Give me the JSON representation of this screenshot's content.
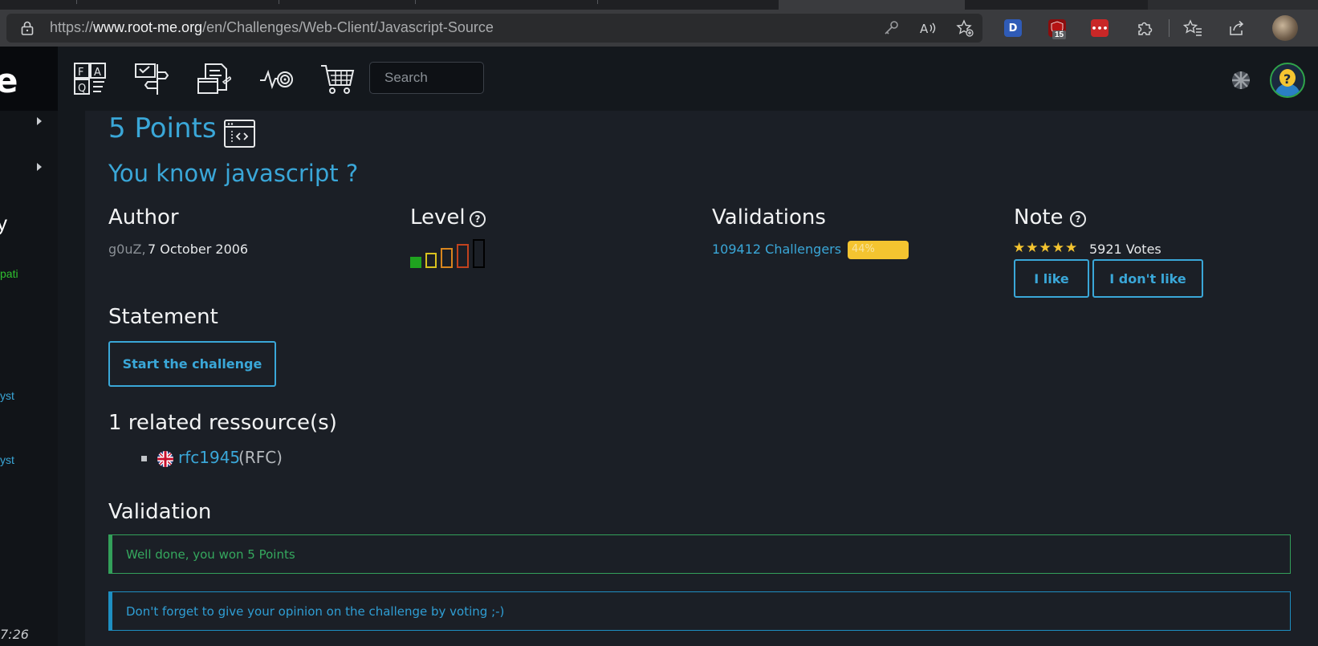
{
  "browser": {
    "url_prefix": "https://",
    "url_host": "www.root-me.org",
    "url_path": "/en/Challenges/Web-Client/Javascript-Source",
    "extension_badge": "15",
    "extension_d_label": "D",
    "extension_dots_label": "•••"
  },
  "site": {
    "search_placeholder": "Search",
    "logo_char": "e",
    "sidebar_fragments": {
      "big": "y",
      "green": "pati",
      "link1": "yst",
      "link2": "yst"
    },
    "clock": "7:26"
  },
  "challenge": {
    "points": "5 Points",
    "subtitle": "You know javascript ?",
    "author_heading": "Author",
    "author_name": "g0uZ",
    "author_sep": ",",
    "author_date": "7 October 2006",
    "level_heading": "Level",
    "validations_heading": "Validations",
    "validations_link": "109412 Challengers",
    "validations_percent_label": "44%",
    "validations_fraction": 0.44,
    "note_heading": "Note",
    "stars": "★★★★★",
    "rating_stars": 5,
    "votes": "5921 Votes",
    "like_label": "I like",
    "dislike_label": "I don't like",
    "statement_heading": "Statement",
    "start_label": "Start the challenge",
    "resources_heading": "1 related ressource(s)",
    "resource_link": "rfc1945",
    "resource_type": "(RFC)",
    "validation_heading": "Validation",
    "success_message": "Well done, you won 5 Points",
    "info_message": "Don't forget to give your opinion on the challenge by voting ;-)"
  },
  "colors": {
    "accent": "#3aa7d8",
    "success": "#33a05a",
    "progress": "#f4c430",
    "level": [
      "#1fa31f",
      "#d8c21e",
      "#d9861e",
      "#c2421e",
      "#000000"
    ]
  }
}
